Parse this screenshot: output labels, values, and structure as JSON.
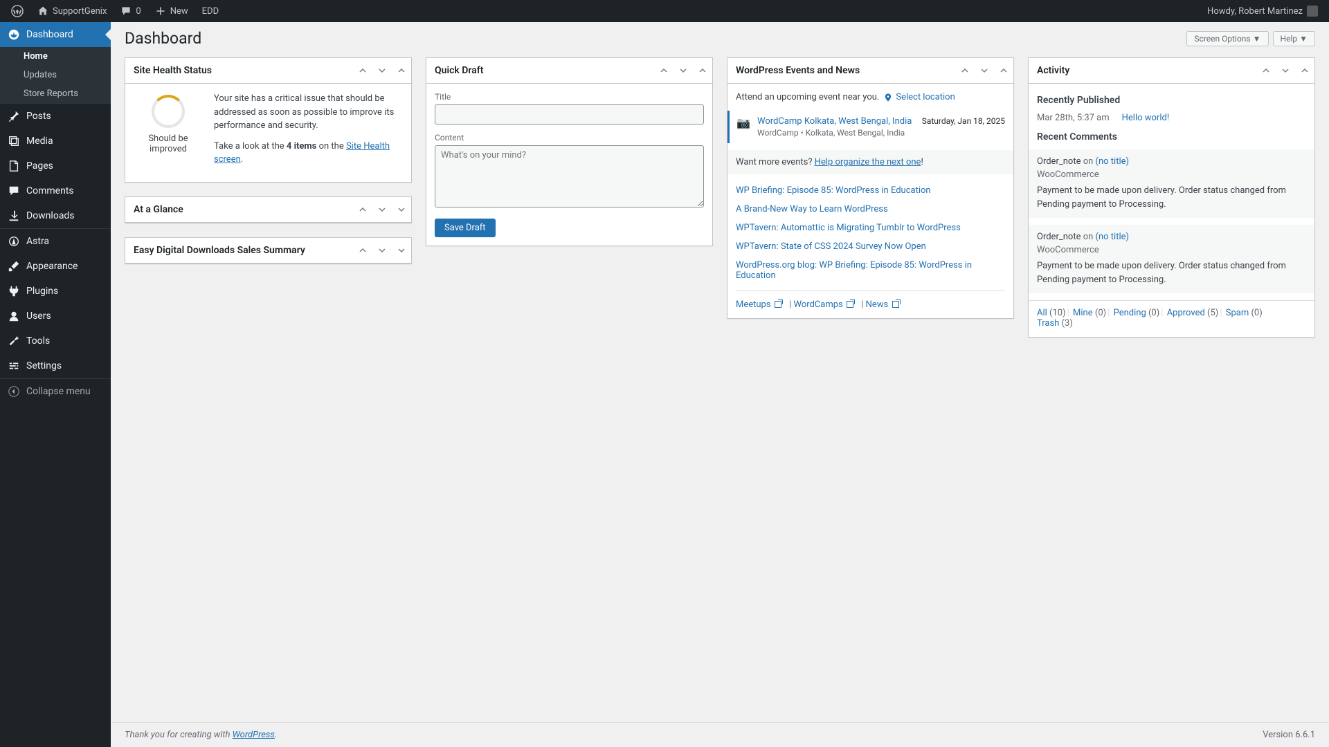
{
  "adminbar": {
    "site_name": "SupportGenix",
    "comments_count": "0",
    "new_label": "New",
    "edd_label": "EDD",
    "howdy": "Howdy, Robert Martinez"
  },
  "sidebar": {
    "items": [
      {
        "label": "Dashboard"
      },
      {
        "label": "Posts"
      },
      {
        "label": "Media"
      },
      {
        "label": "Pages"
      },
      {
        "label": "Comments"
      },
      {
        "label": "Downloads"
      },
      {
        "label": "Astra"
      },
      {
        "label": "Appearance"
      },
      {
        "label": "Plugins"
      },
      {
        "label": "Users"
      },
      {
        "label": "Tools"
      },
      {
        "label": "Settings"
      },
      {
        "label": "Collapse menu"
      }
    ],
    "submenu": {
      "home": "Home",
      "updates": "Updates",
      "store_reports": "Store Reports"
    }
  },
  "page": {
    "title": "Dashboard",
    "screen_options": "Screen Options",
    "help": "Help"
  },
  "health": {
    "title": "Site Health Status",
    "gauge_label": "Should be improved",
    "p1": "Your site has a critical issue that should be addressed as soon as possible to improve its performance and security.",
    "p2_pre": "Take a look at the ",
    "p2_bold": "4 items",
    "p2_mid": " on the ",
    "p2_link": "Site Health screen",
    "p2_post": "."
  },
  "glance": {
    "title": "At a Glance"
  },
  "edd": {
    "title": "Easy Digital Downloads Sales Summary"
  },
  "draft": {
    "title": "Quick Draft",
    "title_label": "Title",
    "content_label": "Content",
    "placeholder": "What's on your mind?",
    "save_btn": "Save Draft"
  },
  "events": {
    "title": "WordPress Events and News",
    "attend": "Attend an upcoming event near you.",
    "select_location": "Select location",
    "event": {
      "name": "WordCamp Kolkata, West Bengal, India",
      "location": "WordCamp • Kolkata, West Bengal, India",
      "date": "Saturday, Jan 18, 2025"
    },
    "want_more": "Want more events? ",
    "organize_link": "Help organize the next one",
    "organize_excl": "!",
    "news": [
      "WP Briefing: Episode 85: WordPress in Education",
      "A Brand-New Way to Learn WordPress",
      "WPTavern: Automattic is Migrating Tumblr to WordPress",
      "WPTavern: State of CSS 2024 Survey Now Open",
      "WordPress.org blog: WP Briefing: Episode 85: WordPress in Education"
    ],
    "footer": {
      "meetups": "Meetups",
      "wordcamps": "WordCamps",
      "news": "News"
    }
  },
  "activity": {
    "title": "Activity",
    "recently_published": "Recently Published",
    "pub_date": "Mar 28th, 5:37 am",
    "pub_title": "Hello world!",
    "recent_comments": "Recent Comments",
    "comments": [
      {
        "meta_pre": "Order_note ",
        "meta_on": "on ",
        "meta_link": "(no title)",
        "src": "WooCommerce",
        "text": "Payment to be made upon delivery. Order status changed from Pending payment to Processing."
      },
      {
        "meta_pre": "Order_note ",
        "meta_on": "on ",
        "meta_link": "(no title)",
        "src": "WooCommerce",
        "text": "Payment to be made upon delivery. Order status changed from Pending payment to Processing."
      }
    ],
    "filters": {
      "all": "All",
      "all_c": " (10)",
      "mine": "Mine",
      "mine_c": " (0)",
      "pending": "Pending",
      "pending_c": " (0)",
      "approved": "Approved",
      "approved_c": " (5)",
      "spam": "Spam",
      "spam_c": " (0)",
      "trash": "Trash",
      "trash_c": " (3)"
    }
  },
  "footer": {
    "thanks_pre": "Thank you for creating with ",
    "wp_link": "WordPress",
    "thanks_post": ".",
    "version": "Version 6.6.1"
  }
}
